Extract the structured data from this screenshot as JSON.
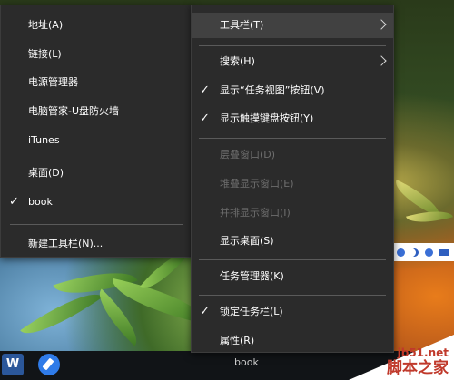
{
  "toolbar_submenu": {
    "items": [
      {
        "label": "地址(A)",
        "checked": false
      },
      {
        "label": "链接(L)",
        "checked": false
      },
      {
        "label": "电源管理器",
        "checked": false
      },
      {
        "label": "电脑管家-U盘防火墙",
        "checked": false
      },
      {
        "label": "iTunes",
        "checked": false
      },
      {
        "label": "桌面(D)",
        "checked": false
      },
      {
        "label": "book",
        "checked": true
      }
    ],
    "new_toolbar_label": "新建工具栏(N)..."
  },
  "context_menu": {
    "toolbars_label": "工具栏(T)",
    "search_label": "搜索(H)",
    "show_task_view_label": "显示“任务视图”按钮(V)",
    "show_touch_keyboard_label": "显示触摸键盘按钮(Y)",
    "cascade_label": "层叠窗口(D)",
    "stacked_label": "堆叠显示窗口(E)",
    "side_by_side_label": "并排显示窗口(I)",
    "show_desktop_label": "显示桌面(S)",
    "task_manager_label": "任务管理器(K)",
    "lock_taskbar_label": "锁定任务栏(L)",
    "properties_label": "属性(R)"
  },
  "check_glyph": "✓",
  "taskbar": {
    "word_letter": "W",
    "book_label": "book"
  },
  "watermark": {
    "site": "jb51.net",
    "name": "脚本之家"
  },
  "colors": {
    "menu_background": "#2b2b2b",
    "menu_highlight": "#414141",
    "disabled_text": "#6d6d6d",
    "watermark_red": "#c0392b"
  }
}
